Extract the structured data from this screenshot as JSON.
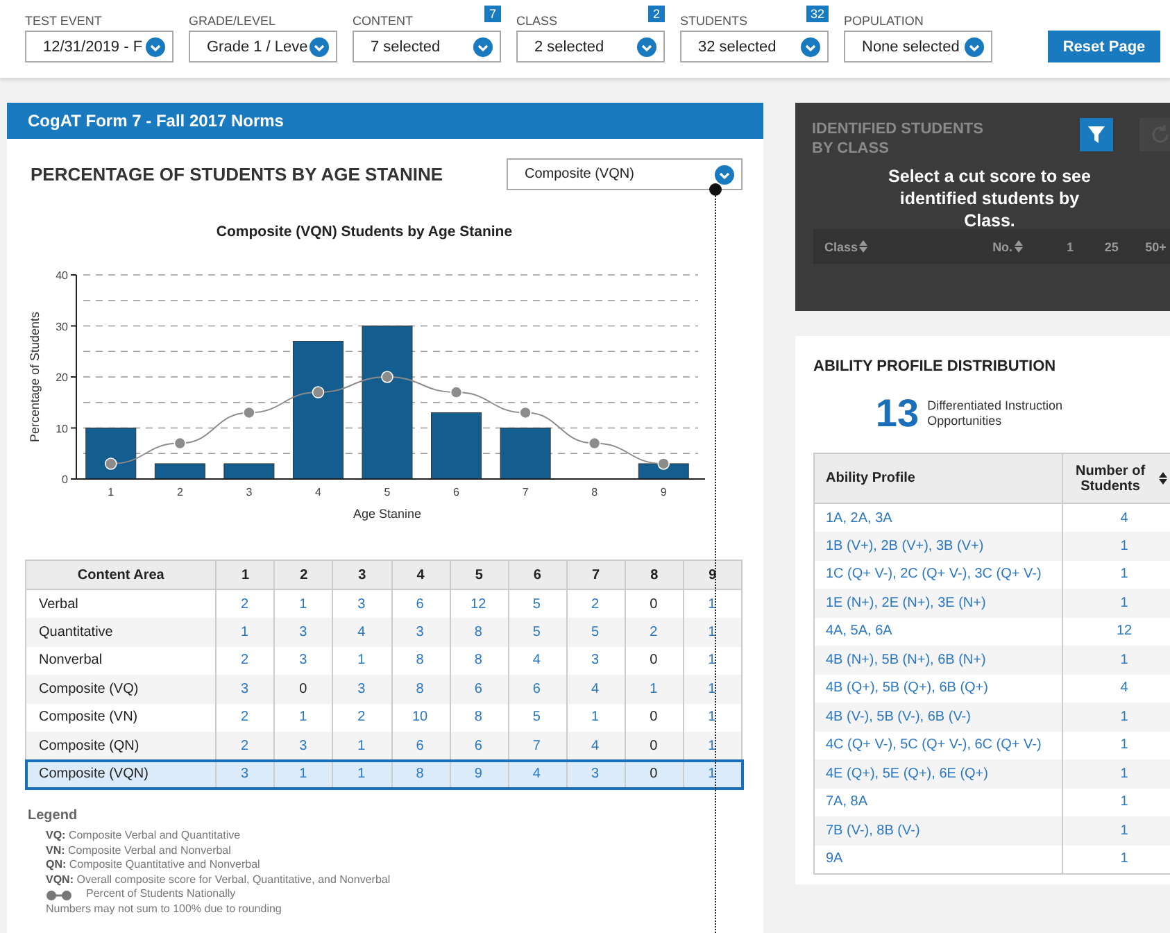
{
  "filters": [
    {
      "label": "TEST EVENT",
      "value": "12/31/2019 - F"
    },
    {
      "label": "GRADE/LEVEL",
      "value": "Grade 1 / Leve"
    },
    {
      "label": "CONTENT",
      "value": "7 selected",
      "badge": "7"
    },
    {
      "label": "CLASS",
      "value": "2 selected",
      "badge": "2"
    },
    {
      "label": "STUDENTS",
      "value": "32 selected",
      "badge": "32"
    },
    {
      "label": "POPULATION",
      "value": "None selected"
    }
  ],
  "reset_button": "Reset Page",
  "panel": {
    "header": "CogAT Form 7 - Fall 2017 Norms",
    "title": "PERCENTAGE OF STUDENTS BY AGE STANINE",
    "dropdown": "Composite (VQN)",
    "chart_data": {
      "type": "bar",
      "title": "Composite (VQN) Students by Age Stanine",
      "xlabel": "Age Stanine",
      "ylabel": "Percentage of Students",
      "categories": [
        "1",
        "2",
        "3",
        "4",
        "5",
        "6",
        "7",
        "8",
        "9"
      ],
      "ylim": [
        0,
        40
      ],
      "yticks": [
        0,
        10,
        20,
        30,
        40
      ],
      "grid": true,
      "series": [
        {
          "color": "#135d8f",
          "values": [
            10,
            3,
            3,
            27,
            30,
            13,
            10,
            0,
            3
          ]
        },
        {
          "type": "line",
          "marker": true,
          "name": "Percent of Students Nationally",
          "color": "#8c8c8c",
          "values": [
            3,
            7,
            13,
            17,
            20,
            17,
            13,
            7,
            3
          ]
        }
      ]
    },
    "table": {
      "columns": [
        "Content Area",
        "1",
        "2",
        "3",
        "4",
        "5",
        "6",
        "7",
        "8",
        "9"
      ],
      "rows": [
        {
          "selected": false,
          "cells": [
            {
              "v": "Verbal",
              "link": false
            },
            {
              "v": "2",
              "link": true
            },
            {
              "v": "1",
              "link": true
            },
            {
              "v": "3",
              "link": true
            },
            {
              "v": "6",
              "link": true
            },
            {
              "v": "12",
              "link": true
            },
            {
              "v": "5",
              "link": true
            },
            {
              "v": "2",
              "link": true
            },
            {
              "v": "0",
              "link": false
            },
            {
              "v": "1",
              "link": true
            }
          ]
        },
        {
          "selected": false,
          "cells": [
            {
              "v": "Quantitative",
              "link": false
            },
            {
              "v": "1",
              "link": true
            },
            {
              "v": "3",
              "link": true
            },
            {
              "v": "4",
              "link": true
            },
            {
              "v": "3",
              "link": true
            },
            {
              "v": "8",
              "link": true
            },
            {
              "v": "5",
              "link": true
            },
            {
              "v": "5",
              "link": true
            },
            {
              "v": "2",
              "link": true
            },
            {
              "v": "1",
              "link": true
            }
          ]
        },
        {
          "selected": false,
          "cells": [
            {
              "v": "Nonverbal",
              "link": false
            },
            {
              "v": "2",
              "link": true
            },
            {
              "v": "3",
              "link": true
            },
            {
              "v": "1",
              "link": true
            },
            {
              "v": "8",
              "link": true
            },
            {
              "v": "8",
              "link": true
            },
            {
              "v": "4",
              "link": true
            },
            {
              "v": "3",
              "link": true
            },
            {
              "v": "0",
              "link": false
            },
            {
              "v": "1",
              "link": true
            }
          ]
        },
        {
          "selected": false,
          "cells": [
            {
              "v": "Composite (VQ)",
              "link": false
            },
            {
              "v": "3",
              "link": true
            },
            {
              "v": "0",
              "link": false
            },
            {
              "v": "3",
              "link": true
            },
            {
              "v": "8",
              "link": true
            },
            {
              "v": "6",
              "link": true
            },
            {
              "v": "6",
              "link": true
            },
            {
              "v": "4",
              "link": true
            },
            {
              "v": "1",
              "link": true
            },
            {
              "v": "1",
              "link": true
            }
          ]
        },
        {
          "selected": false,
          "cells": [
            {
              "v": "Composite (VN)",
              "link": false
            },
            {
              "v": "2",
              "link": true
            },
            {
              "v": "1",
              "link": true
            },
            {
              "v": "2",
              "link": true
            },
            {
              "v": "10",
              "link": true
            },
            {
              "v": "8",
              "link": true
            },
            {
              "v": "5",
              "link": true
            },
            {
              "v": "1",
              "link": true
            },
            {
              "v": "0",
              "link": false
            },
            {
              "v": "1",
              "link": true
            }
          ]
        },
        {
          "selected": false,
          "cells": [
            {
              "v": "Composite (QN)",
              "link": false
            },
            {
              "v": "2",
              "link": true
            },
            {
              "v": "3",
              "link": true
            },
            {
              "v": "1",
              "link": true
            },
            {
              "v": "6",
              "link": true
            },
            {
              "v": "6",
              "link": true
            },
            {
              "v": "7",
              "link": true
            },
            {
              "v": "4",
              "link": true
            },
            {
              "v": "0",
              "link": false
            },
            {
              "v": "1",
              "link": true
            }
          ]
        },
        {
          "selected": true,
          "cells": [
            {
              "v": "Composite (VQN)",
              "link": false
            },
            {
              "v": "3",
              "link": true
            },
            {
              "v": "1",
              "link": true
            },
            {
              "v": "1",
              "link": true
            },
            {
              "v": "8",
              "link": true
            },
            {
              "v": "9",
              "link": true
            },
            {
              "v": "4",
              "link": true
            },
            {
              "v": "3",
              "link": true
            },
            {
              "v": "0",
              "link": false
            },
            {
              "v": "1",
              "link": true
            }
          ]
        }
      ]
    },
    "legend": {
      "title": "Legend",
      "items": [
        "**VQ:** Composite Verbal and Quantitative",
        "**VN:** Composite Verbal and Nonverbal",
        "**QN:** Composite Quantitative and Nonverbal",
        "**VQN:** Overall composite score for Verbal, Quantitative, and Nonverbal"
      ],
      "note": "Numbers may not sum to 100% due to rounding"
    }
  },
  "identified": {
    "title": "IDENTIFIED STUDENTS BY CLASS",
    "message": "Select a cut score to see identified students by Class.",
    "columns": [
      "Class",
      "No.",
      "1",
      "25",
      "50+"
    ]
  },
  "ability": {
    "title": "ABILITY PROFILE DISTRIBUTION",
    "count": "13",
    "count_label": "Differentiated Instruction Opportunities",
    "columns": [
      "Ability Profile",
      "Number of Students"
    ],
    "rows": [
      {
        "profile": "1A, 2A, 3A",
        "count": "4"
      },
      {
        "profile": "1B (V+), 2B (V+), 3B (V+)",
        "count": "1"
      },
      {
        "profile": "1C (Q+ V-), 2C (Q+ V-), 3C (Q+ V-)",
        "count": "1"
      },
      {
        "profile": "1E (N+), 2E (N+), 3E (N+)",
        "count": "1"
      },
      {
        "profile": "4A, 5A, 6A",
        "count": "12"
      },
      {
        "profile": "4B (N+), 5B (N+), 6B (N+)",
        "count": "1"
      },
      {
        "profile": "4B (Q+), 5B (Q+), 6B (Q+)",
        "count": "4"
      },
      {
        "profile": "4B (V-), 5B (V-), 6B (V-)",
        "count": "1"
      },
      {
        "profile": "4C (Q+ V-), 5C (Q+ V-), 6C (Q+ V-)",
        "count": "1"
      },
      {
        "profile": "4E (Q+), 5E (Q+), 6E (Q+)",
        "count": "1"
      },
      {
        "profile": "7A, 8A",
        "count": "1"
      },
      {
        "profile": "7B (V-), 8B (V-)",
        "count": "1"
      },
      {
        "profile": "9A",
        "count": "1"
      }
    ]
  }
}
